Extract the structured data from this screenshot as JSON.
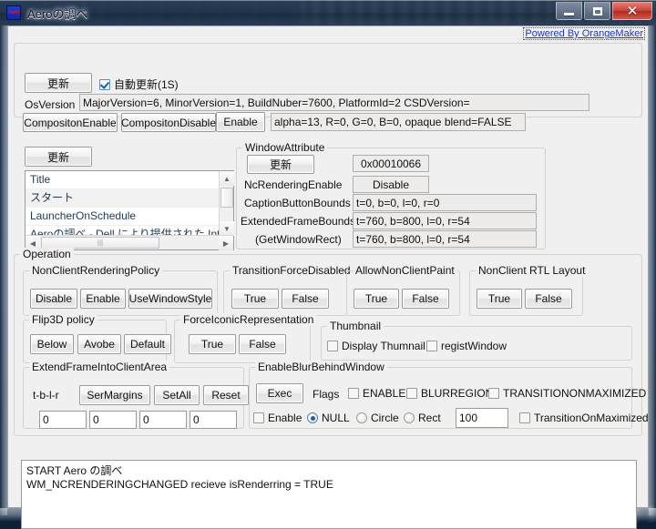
{
  "window": {
    "title": "Aeroの調べ",
    "icon_name": "app-icon",
    "minimize_label": "Minimize",
    "maximize_label": "Maximize",
    "close_label": "✕"
  },
  "powered_link": "Powered By OrangeMaker",
  "top": {
    "refresh_label": "更新",
    "auto_refresh_label": "自動更新(1S)",
    "auto_refresh_checked": true,
    "osversion_label": "OsVersion",
    "osversion_value": "MajorVersion=6, MinorVersion=1, BuildNuber=7600, PlatformId=2 CSDVersion=",
    "composition_enable_label": "CompositonEnable",
    "composition_disable_label": "CompositonDisable",
    "enable_label": "Enable",
    "blend_value": "alpha=13, R=0, G=0, B=0, opaque blend=FALSE"
  },
  "list": {
    "refresh_label": "更新",
    "header": "Title",
    "items": [
      "スタート",
      "LauncherOnSchedule",
      "Aeroの調べ - Dell により提供された Int..."
    ]
  },
  "window_attribute": {
    "caption": "WindowAttribute",
    "refresh_label": "更新",
    "handle_value": "0x00010066",
    "nc_rendering_enable_label": "NcRenderingEnable",
    "nc_rendering_enable_value": "Disable",
    "caption_button_bounds_label": "CaptionButtonBounds",
    "caption_button_bounds_value": "t=0, b=0, l=0, r=0",
    "extended_frame_bounds_label": "ExtendedFrameBounds",
    "extended_frame_bounds_value": "t=760, b=800, l=0, r=54",
    "get_window_rect_label": "(GetWindowRect)",
    "get_window_rect_value": "t=760, b=800, l=0, r=54"
  },
  "operation": {
    "caption": "Operation",
    "nonclient_rendering_policy": {
      "caption": "NonClientRenderingPolicy",
      "buttons": [
        "Disable",
        "Enable",
        "UseWindowStyle"
      ]
    },
    "transition_force_disabled": {
      "caption": "TransitionForceDisabled",
      "buttons": [
        "True",
        "False"
      ]
    },
    "allow_nonclient_paint": {
      "caption": "AllowNonClientPaint",
      "buttons": [
        "True",
        "False"
      ]
    },
    "nonclient_rtl_layout": {
      "caption": "NonClient RTL Layout",
      "buttons": [
        "True",
        "False"
      ]
    },
    "flip3d_policy": {
      "caption": "Flip3D policy",
      "buttons": [
        "Below",
        "Avobe",
        "Default"
      ]
    },
    "force_iconic_representation": {
      "caption": "ForceIconicRepresentation",
      "buttons": [
        "True",
        "False"
      ]
    },
    "thumbnail": {
      "caption": "Thumbnail",
      "display_thumbnail_label": "Display Thumnail",
      "display_thumbnail_checked": false,
      "regist_window_label": "registWindow",
      "regist_window_checked": false
    },
    "extend_frame": {
      "caption": "ExtendFrameIntoClientArea",
      "tblr_label": "t-b-l-r",
      "set_margins_label": "SerMargins",
      "set_all_label": "SetAll",
      "reset_label": "Reset",
      "values": [
        "0",
        "0",
        "0",
        "0"
      ]
    },
    "enable_blur": {
      "caption": "EnableBlurBehindWindow",
      "exec_label": "Exec",
      "flags_label": "Flags",
      "flag_enable_label": "ENABLE",
      "flag_enable_checked": false,
      "flag_blurregion_label": "BLURREGION",
      "flag_blurregion_checked": false,
      "flag_transitiononmaximized_label": "TRANSITIONONMAXIMIZED",
      "flag_transitiononmaximized_checked": false,
      "enable_label": "Enable",
      "enable_checked": false,
      "region_null_label": "NULL",
      "region_circle_label": "Circle",
      "region_rect_label": "Rect",
      "region_selected": "NULL",
      "region_size_value": "100",
      "transition_on_maximized_label": "TransitionOnMaximized",
      "transition_on_maximized_checked": false
    }
  },
  "log": {
    "line1": "START Aero の調べ",
    "line2": "WM_NCRENDERINGCHANGED recieve isRenderring = TRUE"
  }
}
